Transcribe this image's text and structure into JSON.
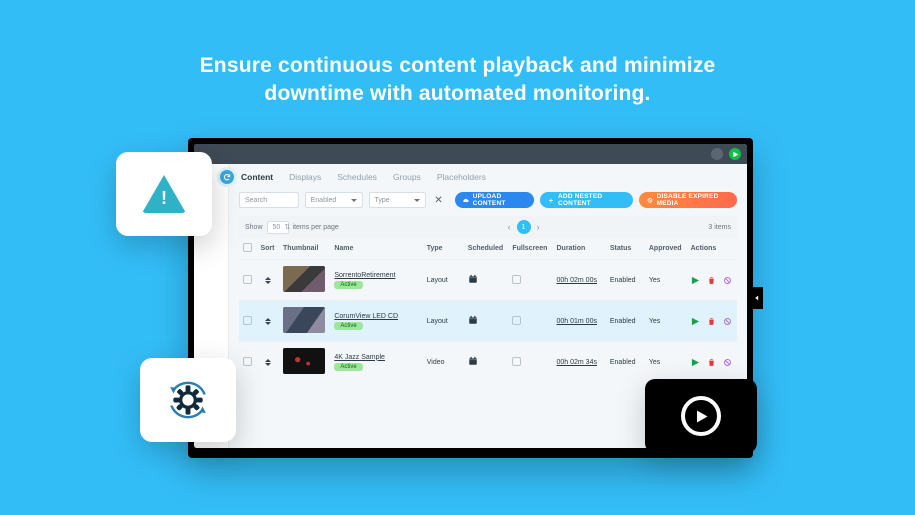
{
  "headline_l1": "Ensure continuous content playback and minimize",
  "headline_l2": "downtime with automated monitoring.",
  "tabs": [
    "Content",
    "Displays",
    "Schedules",
    "Groups",
    "Placeholders"
  ],
  "active_tab_index": 0,
  "toolbar": {
    "search_placeholder": "Search",
    "filter_enabled": "Enabled",
    "filter_type": "Type",
    "upload": "UPLOAD CONTENT",
    "nested": "ADD NESTED CONTENT",
    "disable": "DISABLE EXPIRED MEDIA"
  },
  "pager": {
    "show_label": "Show",
    "per_page": "50",
    "per_page_suffix": "items per page",
    "page": "1",
    "total": "3 items"
  },
  "columns": {
    "sort": "Sort",
    "thumb": "Thumbnail",
    "name": "Name",
    "type": "Type",
    "scheduled": "Scheduled",
    "fullscreen": "Fullscreen",
    "duration": "Duration",
    "status": "Status",
    "approved": "Approved",
    "actions": "Actions"
  },
  "rows": [
    {
      "name": "SorrentoRetirement",
      "badge": "Active",
      "type": "Layout",
      "duration": "00h 02m 00s",
      "status": "Enabled",
      "approved": "Yes",
      "thumb_class": "t1"
    },
    {
      "name": "CorumView LED CD",
      "badge": "Active",
      "type": "Layout",
      "duration": "00h 01m 00s",
      "status": "Enabled",
      "approved": "Yes",
      "thumb_class": "t2",
      "highlight": true
    },
    {
      "name": "4K Jazz Sample",
      "badge": "Active",
      "type": "Video",
      "duration": "00h 02m 34s",
      "status": "Enabled",
      "approved": "Yes",
      "thumb_class": "t3"
    }
  ]
}
